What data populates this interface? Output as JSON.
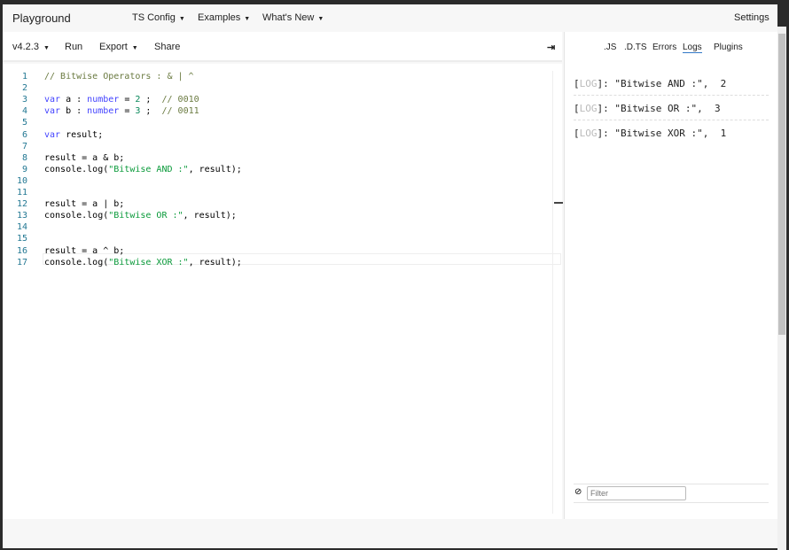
{
  "topbar": {
    "brand": "Playground",
    "nav": [
      "TS Config",
      "Examples",
      "What's New"
    ],
    "settings": "Settings"
  },
  "toolbar": {
    "version": "v4.2.3",
    "run": "Run",
    "export": "Export",
    "share": "Share",
    "collapse_icon": "⇥"
  },
  "editor": {
    "lines": [
      [
        [
          "cm",
          "// Bitwise Operators : & | ^"
        ]
      ],
      [],
      [
        [
          "kw",
          "var"
        ],
        [
          "t",
          " a : "
        ],
        [
          "kw",
          "number"
        ],
        [
          "t",
          " = "
        ],
        [
          "num",
          "2"
        ],
        [
          "t",
          " ;  "
        ],
        [
          "cm",
          "// 0010"
        ]
      ],
      [
        [
          "kw",
          "var"
        ],
        [
          "t",
          " b : "
        ],
        [
          "kw",
          "number"
        ],
        [
          "t",
          " = "
        ],
        [
          "num",
          "3"
        ],
        [
          "t",
          " ;  "
        ],
        [
          "cm",
          "// 0011"
        ]
      ],
      [],
      [
        [
          "kw",
          "var"
        ],
        [
          "t",
          " result;"
        ]
      ],
      [],
      [
        [
          "t",
          "result = a & b;"
        ]
      ],
      [
        [
          "t",
          "console.log("
        ],
        [
          "str",
          "\"Bitwise AND :\""
        ],
        [
          "t",
          ", result);"
        ]
      ],
      [],
      [],
      [
        [
          "t",
          "result = a | b;"
        ]
      ],
      [
        [
          "t",
          "console.log("
        ],
        [
          "str",
          "\"Bitwise OR :\""
        ],
        [
          "t",
          ", result);"
        ]
      ],
      [],
      [],
      [
        [
          "t",
          "result = a ^ b;"
        ]
      ],
      [
        [
          "t",
          "console.log("
        ],
        [
          "str",
          "\"Bitwise XOR :\""
        ],
        [
          "t",
          ", result);"
        ]
      ]
    ]
  },
  "sidebar": {
    "tabs": [
      ".JS",
      ".D.TS",
      "Errors",
      "Logs",
      "Plugins"
    ],
    "active_tab": "Logs",
    "logs": [
      {
        "tag": "LOG",
        "text": "\"Bitwise AND :\",  2"
      },
      {
        "tag": "LOG",
        "text": "\"Bitwise OR :\",  3"
      },
      {
        "tag": "LOG",
        "text": "\"Bitwise XOR :\",  1"
      }
    ],
    "filter_placeholder": "Filter"
  }
}
